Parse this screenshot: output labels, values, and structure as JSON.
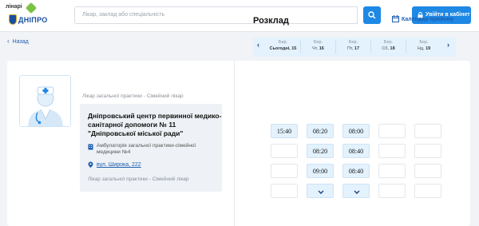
{
  "header": {
    "logo_small": "лінарі",
    "logo_city": "ДНІПРО",
    "search_placeholder": "Лікар, заклад або спеціальність",
    "login_label": "Увійти в кабінет"
  },
  "nav": {
    "back_label": "Назад"
  },
  "doctor": {
    "specialty_top": "Лікар загальної практики - Сімейний лікар",
    "clinic_name": "Дніпровський центр первинної медико-санітарної допомоги № 11 \"Дніпровської міської ради\"",
    "ambulatory": "Амбулаторія загальної практики-сімейної медицини №4",
    "address": "вул. Широка, 222",
    "specialty_bottom": "Лікар загальної практики - Сімейний лікар"
  },
  "schedule": {
    "title": "Розклад",
    "calendar_link": "Календар прийому",
    "days": [
      {
        "month": "Бер.",
        "day": "Сьогодні, 15",
        "bold": true
      },
      {
        "month": "Бер.",
        "day_prefix": "Чт, ",
        "day_num": "16"
      },
      {
        "month": "Бер.",
        "day_prefix": "Пт, ",
        "day_num": "17"
      },
      {
        "month": "Бер.",
        "day_prefix": "Сб, ",
        "day_num": "18"
      },
      {
        "month": "Бер.",
        "day_prefix": "Нд, ",
        "day_num": "19"
      }
    ],
    "slots": [
      [
        "15:40",
        "08:20",
        "08:00",
        "",
        ""
      ],
      [
        "",
        "08:20",
        "08:40",
        "",
        ""
      ],
      [
        "",
        "09:00",
        "08:40",
        "",
        ""
      ],
      [
        "",
        "more",
        "more",
        "",
        ""
      ]
    ]
  },
  "colors": {
    "accent": "#1e88e5",
    "link": "#1e5fb0",
    "slot_bg": "#e3f2fd",
    "page_bg": "#f1f3f6"
  }
}
